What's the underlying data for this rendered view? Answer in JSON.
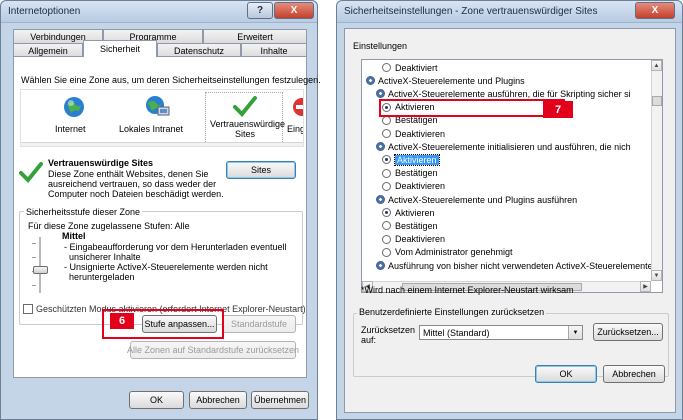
{
  "left_dialog": {
    "title": "Internetoptionen",
    "help_label": "?",
    "close_label": "X",
    "tabs_row1": [
      "Verbindungen",
      "Programme",
      "Erweitert"
    ],
    "tabs_row2": [
      "Allgemein",
      "Sicherheit",
      "Datenschutz",
      "Inhalte"
    ],
    "active_tab": "Sicherheit",
    "zone_prompt": "Wählen Sie eine Zone aus, um deren Sicherheitseinstellungen festzulegen.",
    "zones": [
      {
        "label": "Internet",
        "icon": "globe-icon"
      },
      {
        "label": "Lokales Intranet",
        "icon": "intranet-icon"
      },
      {
        "label": "Vertrauenswürdige Sites",
        "icon": "checkmark-icon"
      },
      {
        "label": "Einge",
        "icon": "restricted-icon"
      }
    ],
    "zone_title": "Vertrauenswürdige Sites",
    "zone_desc": [
      "Diese Zone enthält Websites, denen Sie",
      "ausreichend vertrauen, so dass weder der",
      "Computer noch Dateien beschädigt werden."
    ],
    "sites_button": "Sites",
    "security_level_title": "Sicherheitsstufe dieser Zone",
    "allowed_levels": "Für diese Zone zugelassene Stufen: Alle",
    "level_name": "Mittel",
    "level_desc": [
      "- Eingabeaufforderung vor dem Herunterladen eventuell",
      "  unsicherer Inhalte",
      "- Unsignierte ActiveX-Steuerelemente werden nicht",
      "  heruntergeladen"
    ],
    "protected_mode": "Geschützten Modus aktivieren (erfordert Internet Explorer-Neustart)",
    "custom_level_button": "Stufe anpassen...",
    "default_level_button": "Standardstufe",
    "reset_all_button": "Alle Zonen auf Standardstufe zurücksetzen",
    "ok": "OK",
    "cancel": "Abbrechen",
    "apply": "Übernehmen",
    "step_label": "6"
  },
  "right_dialog": {
    "title": "Sicherheitseinstellungen - Zone vertrauenswürdiger Sites",
    "close_label": "X",
    "settings_label": "Einstellungen",
    "rows": [
      {
        "kind": "radio",
        "text": "Deaktiviert",
        "checked": false
      },
      {
        "kind": "header",
        "text": "ActiveX-Steuerelemente und Plugins"
      },
      {
        "kind": "sub",
        "text": "ActiveX-Steuerelemente ausführen, die für Skripting sicher si"
      },
      {
        "kind": "radio",
        "text": "Aktivieren",
        "checked": true
      },
      {
        "kind": "radio",
        "text": "Bestätigen",
        "checked": false
      },
      {
        "kind": "radio",
        "text": "Deaktivieren",
        "checked": false
      },
      {
        "kind": "sub",
        "text": "ActiveX-Steuerelemente initialisieren und ausführen, die nich"
      },
      {
        "kind": "radio",
        "text": "Aktivieren",
        "checked": true,
        "selected": true
      },
      {
        "kind": "radio",
        "text": "Bestätigen",
        "checked": false
      },
      {
        "kind": "radio",
        "text": "Deaktivieren",
        "checked": false
      },
      {
        "kind": "sub",
        "text": "ActiveX-Steuerelemente und Plugins ausführen"
      },
      {
        "kind": "radio",
        "text": "Aktivieren",
        "checked": true
      },
      {
        "kind": "radio",
        "text": "Bestätigen",
        "checked": false
      },
      {
        "kind": "radio",
        "text": "Deaktivieren",
        "checked": false
      },
      {
        "kind": "radio",
        "text": "Vom Administrator genehmigt",
        "checked": false
      },
      {
        "kind": "sub",
        "text": "Ausführung von bisher nicht verwendeten ActiveX-Steuerelemente"
      }
    ],
    "restart_note": "*Wird nach einem Internet Explorer-Neustart wirksam",
    "reset_group_title": "Benutzerdefinierte Einstellungen zurücksetzen",
    "reset_to_label": "Zurücksetzen auf:",
    "reset_select_value": "Mittel (Standard)",
    "reset_button": "Zurücksetzen...",
    "ok": "OK",
    "cancel": "Abbrechen",
    "step_label": "7"
  }
}
